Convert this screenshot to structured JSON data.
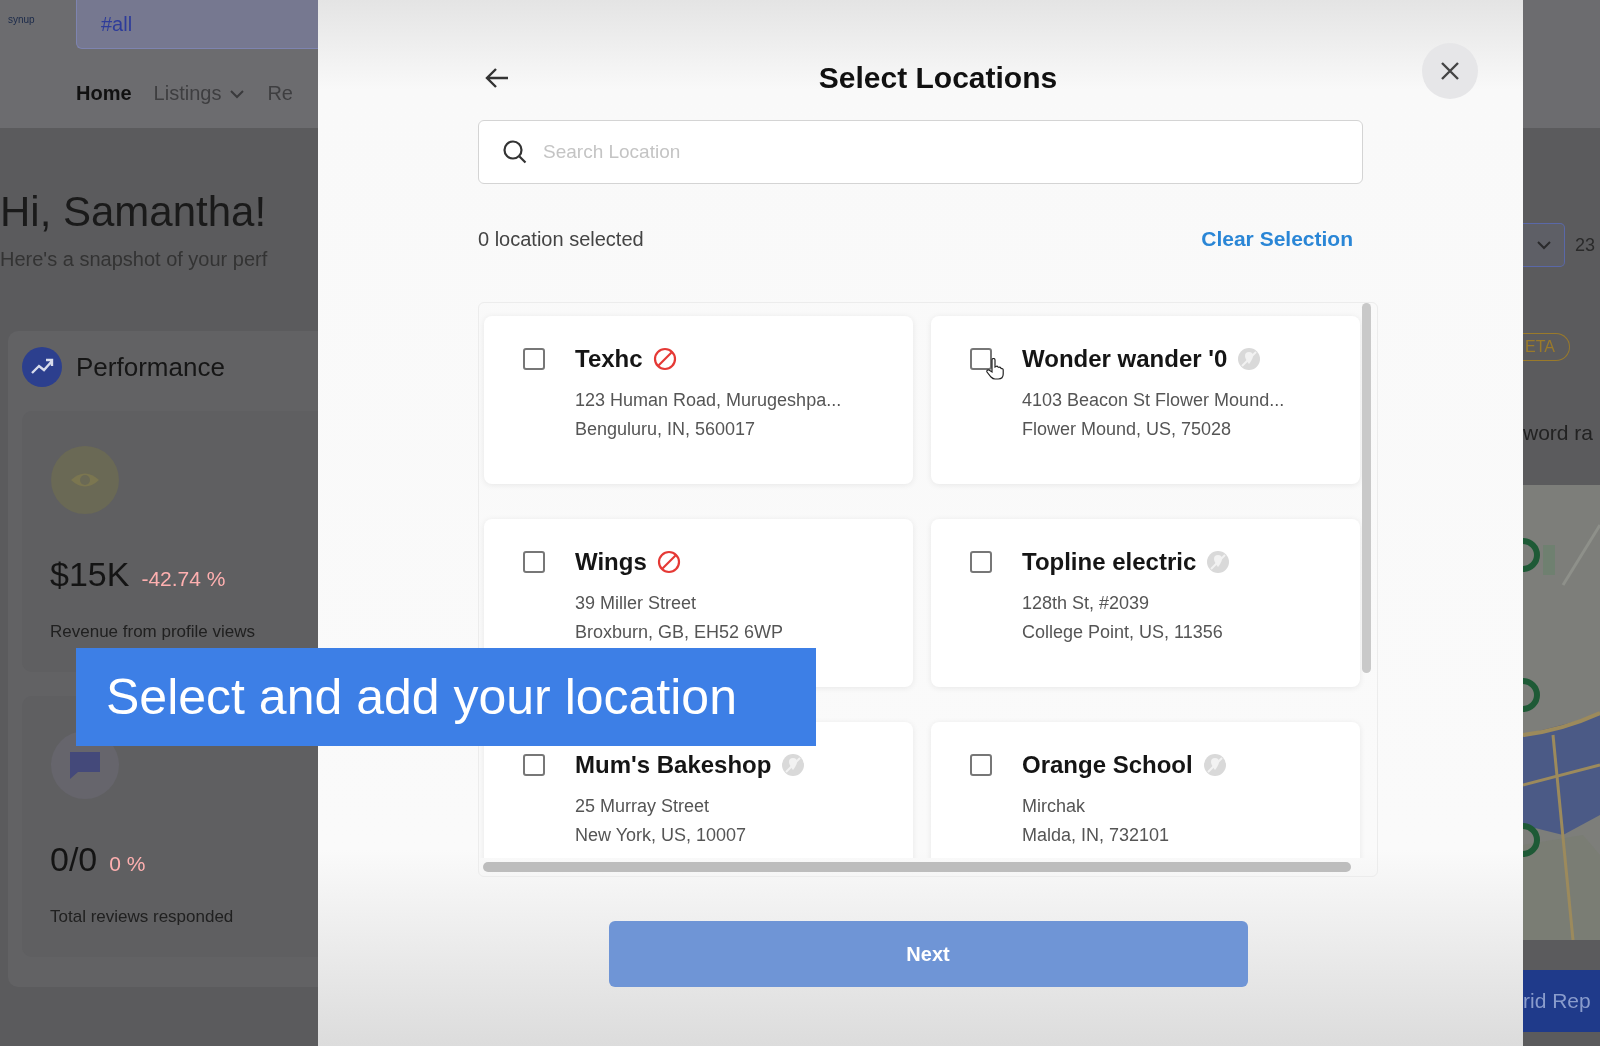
{
  "background": {
    "logo": "synup",
    "search": "#all",
    "nav": [
      {
        "label": "Home",
        "selected": true,
        "dropdown": false
      },
      {
        "label": "Listings",
        "selected": false,
        "dropdown": true
      },
      {
        "label": "Re",
        "selected": false,
        "dropdown": false
      }
    ],
    "greeting": "Hi, Samantha!",
    "subtitle": "Here's a snapshot of your perf",
    "performance": {
      "title": "Performance",
      "metrics": [
        {
          "kind": "eye",
          "value": "$15K",
          "change": "-42.74 %",
          "label": "Revenue from profile views"
        },
        {
          "kind": "chat",
          "value": "0/0",
          "change": "0 %",
          "label": "Total reviews responded"
        }
      ]
    },
    "right": {
      "date": "23",
      "badge": "ETA",
      "heading": "word ra",
      "button": "rid Rep"
    }
  },
  "modal": {
    "title": "Select Locations",
    "search": {
      "placeholder": "Search Location"
    },
    "selected_count": "0 location selected",
    "clear": "Clear Selection",
    "locations": [
      {
        "name": "Texhc",
        "kind": "blocked",
        "checked": false,
        "hovered": false,
        "address": [
          "123 Human Road, Murugeshpa...",
          "Benguluru, IN, 560017"
        ]
      },
      {
        "name": "Wonder wander '0",
        "kind": "unverified",
        "checked": false,
        "hovered": true,
        "address": [
          "4103 Beacon St Flower Mound...",
          "Flower Mound, US, 75028"
        ]
      },
      {
        "name": "Wings",
        "kind": "blocked",
        "checked": false,
        "hovered": false,
        "address": [
          "39 Miller Street",
          "Broxburn, GB, EH52 6WP"
        ]
      },
      {
        "name": "Topline electric",
        "kind": "unverified",
        "checked": false,
        "hovered": false,
        "address": [
          "128th St, #2039",
          "College Point, US, 11356"
        ]
      },
      {
        "name": "Mum's Bakeshop",
        "kind": "unverified",
        "checked": false,
        "hovered": false,
        "address": [
          "25 Murray Street",
          "New York, US, 10007"
        ]
      },
      {
        "name": "Orange School",
        "kind": "unverified",
        "checked": false,
        "hovered": false,
        "address": [
          "Mirchak",
          "Malda, IN, 732101"
        ]
      }
    ],
    "next": {
      "label": "Next",
      "disabled": true
    }
  },
  "caption": "Select and add your location"
}
